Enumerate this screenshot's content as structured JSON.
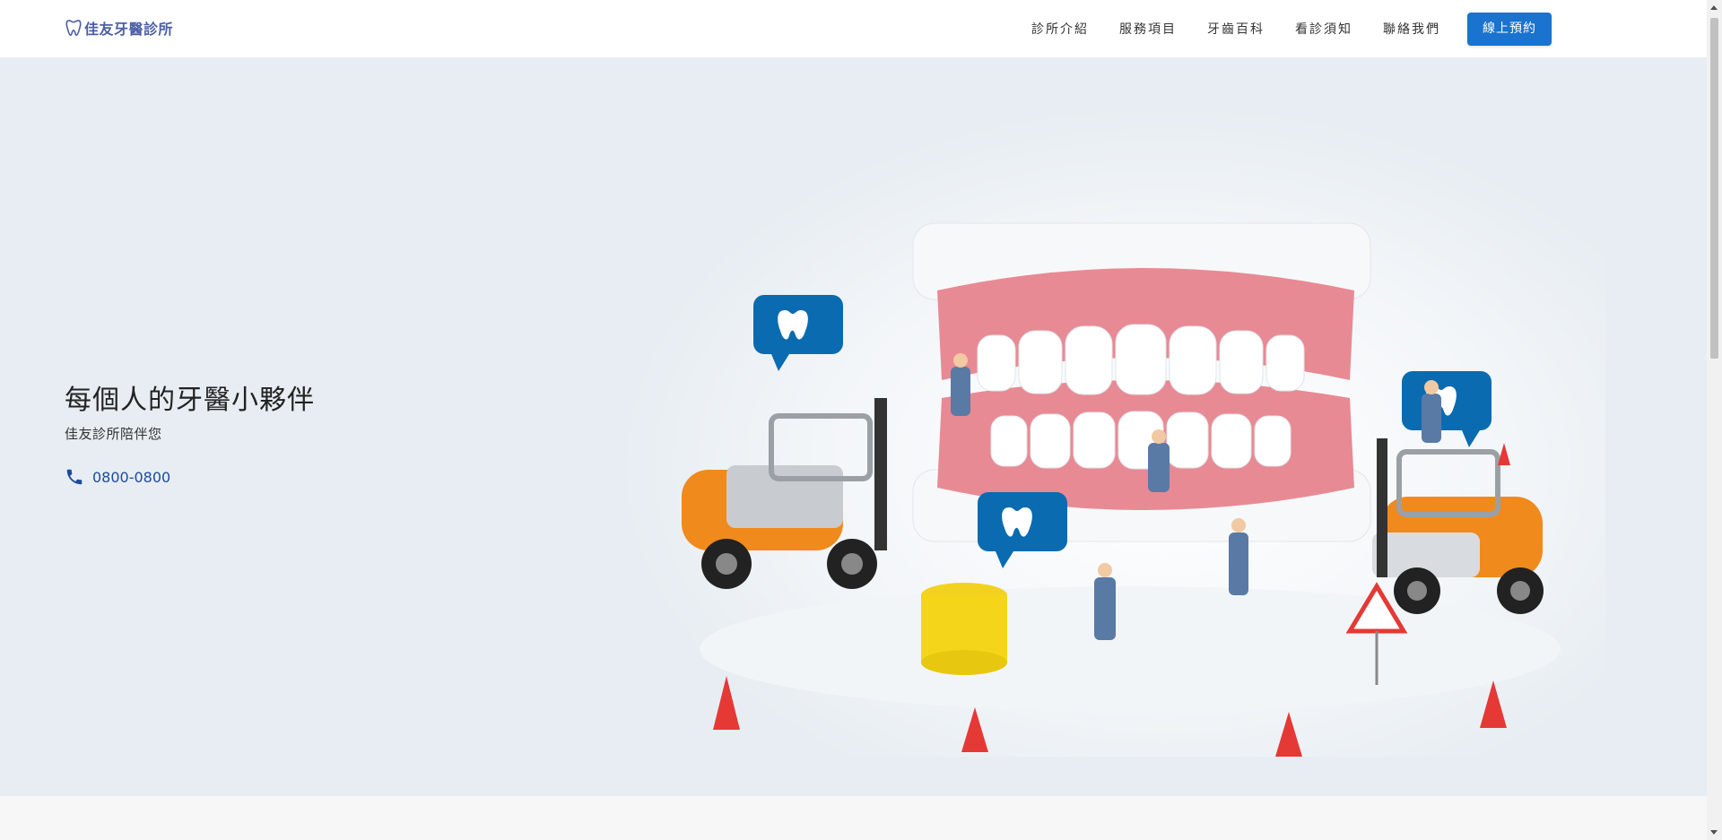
{
  "header": {
    "logo_text": "佳友牙醫診所",
    "nav": [
      "診所介紹",
      "服務項目",
      "牙齒百科",
      "看診須知",
      "聯絡我們"
    ],
    "cta_label": "線上預約"
  },
  "hero": {
    "title": "每個人的牙醫小夥伴",
    "subtitle": "佳友診所陪伴您",
    "phone": "0800-0800",
    "phone_icon": "phone-icon",
    "image_icon": "tooth-speech-bubble-icon"
  },
  "colors": {
    "accent": "#1a73cf",
    "logo": "#4d5fa6",
    "hero_bg": "#e7edf2",
    "bubble": "#0a6bb0",
    "forklift_orange": "#f08a1c",
    "gum": "#e88a94"
  }
}
